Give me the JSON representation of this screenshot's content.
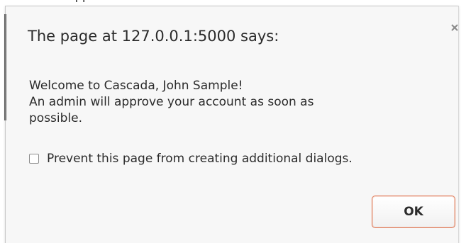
{
  "background": {
    "fragment_text": "approved"
  },
  "dialog": {
    "title": "The page at 127.0.0.1:5000 says:",
    "close_icon": "close-icon",
    "message_lines": [
      "Welcome to Cascada, John Sample!",
      "An admin will approve your account as soon as",
      "possible."
    ],
    "prevent_checkbox": {
      "label": "Prevent this page from creating additional dialogs.",
      "checked": false
    },
    "ok_button_label": "OK"
  },
  "colors": {
    "dialog_background": "#f7f7f7",
    "button_border_accent": "#e07a57",
    "text": "#2b2b2b"
  }
}
